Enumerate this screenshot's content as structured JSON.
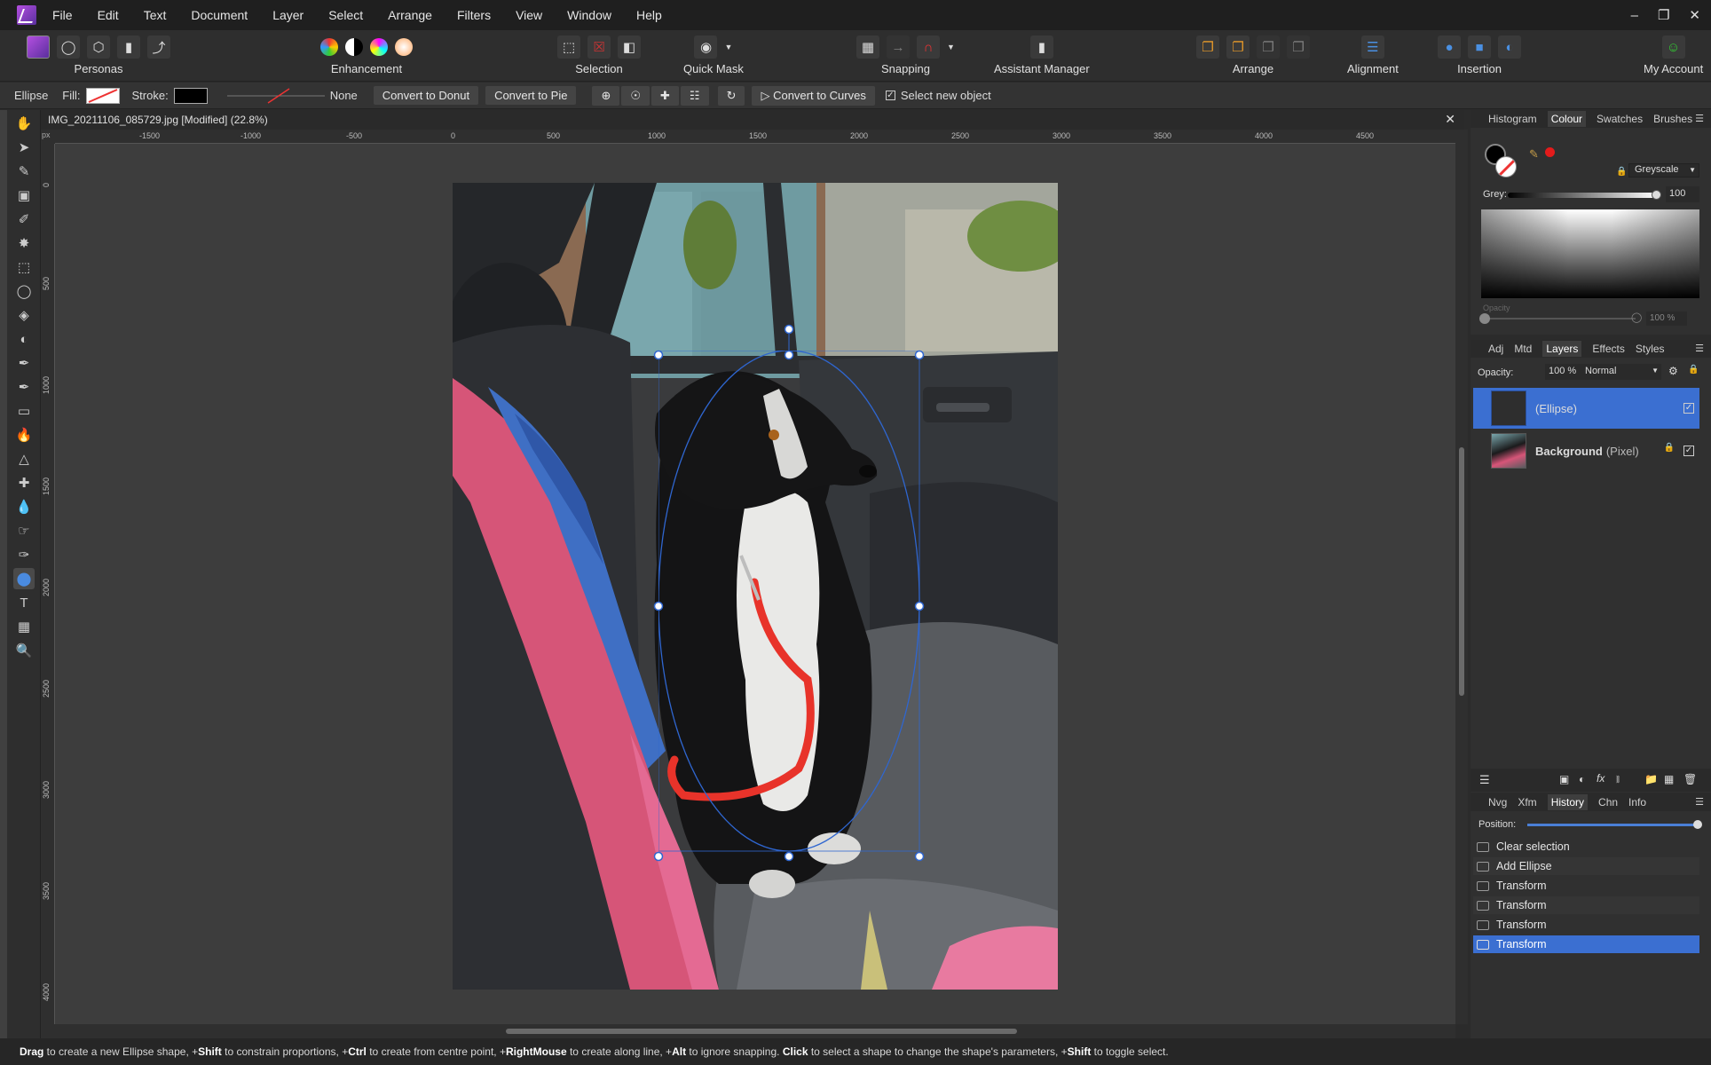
{
  "menu": [
    "File",
    "Edit",
    "Text",
    "Document",
    "Layer",
    "Select",
    "Arrange",
    "Filters",
    "View",
    "Window",
    "Help"
  ],
  "toolbar": {
    "personas_label": "Personas",
    "enhancement_label": "Enhancement",
    "selection_label": "Selection",
    "quickmask_label": "Quick Mask",
    "snapping_label": "Snapping",
    "assistant_label": "Assistant Manager",
    "arrange_label": "Arrange",
    "alignment_label": "Alignment",
    "insertion_label": "Insertion",
    "account_label": "My Account"
  },
  "context": {
    "tool_name": "Ellipse",
    "fill_label": "Fill:",
    "stroke_label": "Stroke:",
    "stroke_none": "None",
    "donut_btn": "Convert to Donut",
    "pie_btn": "Convert to Pie",
    "curves_btn": "Convert to Curves",
    "select_new_label": "Select new object"
  },
  "document": {
    "tab_title": "IMG_20211106_085729.jpg [Modified] (22.8%)",
    "ruler_unit": "px",
    "h_ticks": [
      "-1500",
      "-1000",
      "-500",
      "0",
      "500",
      "1000",
      "1500",
      "2000",
      "2500",
      "3000",
      "3500",
      "4000",
      "4500"
    ],
    "v_ticks": [
      "0",
      "500",
      "1000",
      "1500",
      "2000",
      "2500",
      "3000",
      "3500",
      "4000"
    ]
  },
  "colour_panel": {
    "tabs": [
      "Histogram",
      "Colour",
      "Swatches",
      "Brushes"
    ],
    "active": "Colour",
    "model": "Greyscale",
    "grey_label": "Grey:",
    "grey_value": "100",
    "grey_level": 100,
    "opacity_label": "Opacity",
    "opacity_value": "100 %"
  },
  "layers_panel": {
    "tabs": [
      "Adj",
      "Mtd",
      "Layers",
      "Effects",
      "Styles"
    ],
    "active": "Layers",
    "opacity_label": "Opacity:",
    "opacity_value": "100 %",
    "blend_mode": "Normal",
    "layers": [
      {
        "name": "(Ellipse)",
        "type": ""
      },
      {
        "name": "Background",
        "type": "(Pixel)"
      }
    ]
  },
  "history_panel": {
    "tabs": [
      "Nvg",
      "Xfm",
      "History",
      "Chn",
      "Info"
    ],
    "active": "History",
    "position_label": "Position:",
    "items": [
      "Clear selection",
      "Add Ellipse",
      "Transform",
      "Transform",
      "Transform",
      "Transform"
    ]
  },
  "status": {
    "parts": [
      {
        "b": "Drag",
        "t": " to create a new Ellipse shape, +"
      },
      {
        "b": "Shift",
        "t": " to constrain proportions, +"
      },
      {
        "b": "Ctrl",
        "t": " to create from centre point, +"
      },
      {
        "b": "RightMouse",
        "t": " to create along line, +"
      },
      {
        "b": "Alt",
        "t": " to ignore snapping. "
      },
      {
        "b": "Click",
        "t": " to select a shape to change the shape's parameters, +"
      },
      {
        "b": "Shift",
        "t": " to toggle select."
      }
    ]
  },
  "colors": {
    "accent": "#3b6fd1",
    "selection_blue": "#2f66d0",
    "leash_red": "#e8332a"
  }
}
